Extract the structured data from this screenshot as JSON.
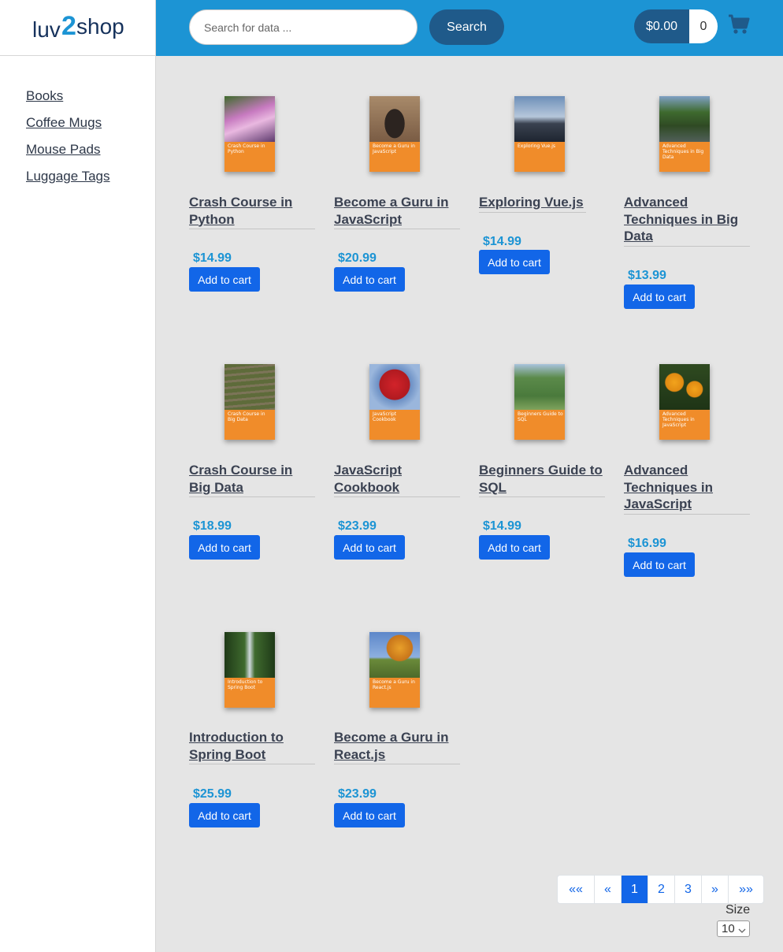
{
  "logo": {
    "text_left": "luv",
    "text_mid": "2",
    "text_right": "shop"
  },
  "sidebar": {
    "items": [
      {
        "label": "Books"
      },
      {
        "label": "Coffee Mugs"
      },
      {
        "label": "Mouse Pads"
      },
      {
        "label": "Luggage Tags"
      }
    ]
  },
  "search": {
    "placeholder": "Search for data ...",
    "button_label": "Search"
  },
  "cart": {
    "total": "$0.00",
    "quantity": "0",
    "icon": "shopping-cart-icon"
  },
  "colors": {
    "header": "#1c94d4",
    "accent": "#1266e8",
    "dark_button": "#1f5a8a",
    "price": "#1c94d4",
    "cover_band": "#f08c2a"
  },
  "products": [
    {
      "name": "Crash Course in Python",
      "price": "$14.99",
      "button": "Add to cart",
      "cover_title": "Crash Course in Python",
      "cover_photo": "pink orchid flowers"
    },
    {
      "name": "Become a Guru in JavaScript",
      "price": "$20.99",
      "button": "Add to cart",
      "cover_title": "Become a Guru in JavaScript",
      "cover_photo": "stone archway"
    },
    {
      "name": "Exploring Vue.js",
      "price": "$14.99",
      "button": "Add to cart",
      "cover_title": "Exploring Vue.js",
      "cover_photo": "city skyline"
    },
    {
      "name": "Advanced Techniques in Big Data",
      "price": "$13.99",
      "button": "Add to cart",
      "cover_title": "Advanced Techniques in Big Data",
      "cover_photo": "river with trees"
    },
    {
      "name": "Crash Course in Big Data",
      "price": "$18.99",
      "button": "Add to cart",
      "cover_title": "Crash Course in Big Data",
      "cover_photo": "stone steps in forest"
    },
    {
      "name": "JavaScript Cookbook",
      "price": "$23.99",
      "button": "Add to cart",
      "cover_title": "JavaScript Cookbook",
      "cover_photo": "red maple tree"
    },
    {
      "name": "Beginners Guide to SQL",
      "price": "$14.99",
      "button": "Add to cart",
      "cover_title": "Beginners Guide to SQL",
      "cover_photo": "aerial park view"
    },
    {
      "name": "Advanced Techniques in JavaScript",
      "price": "$16.99",
      "button": "Add to cart",
      "cover_title": "Advanced Techniques in JavaScript",
      "cover_photo": "orange flowers"
    },
    {
      "name": "Introduction to Spring Boot",
      "price": "$25.99",
      "button": "Add to cart",
      "cover_title": "Introduction to Spring Boot",
      "cover_photo": "waterfall in forest"
    },
    {
      "name": "Become a Guru in React.js",
      "price": "$23.99",
      "button": "Add to cart",
      "cover_title": "Become a Guru in React.js",
      "cover_photo": "autumn tree"
    }
  ],
  "pagination": {
    "first": "««",
    "prev": "«",
    "pages": [
      "1",
      "2",
      "3"
    ],
    "current_page": "1",
    "next": "»",
    "last": "»»"
  },
  "page_size": {
    "label": "Size",
    "value": "10"
  }
}
